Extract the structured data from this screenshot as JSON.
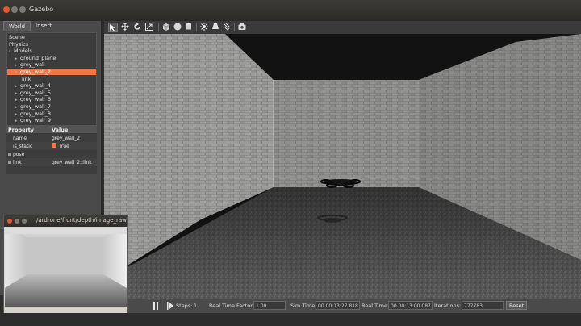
{
  "window": {
    "title": "Gazebo"
  },
  "left_panel": {
    "tabs": [
      "World",
      "Insert"
    ],
    "tree": [
      {
        "label": "Scene",
        "indent": 0
      },
      {
        "label": "Physics",
        "indent": 0
      },
      {
        "label": "Models",
        "indent": 0,
        "expanded": true
      },
      {
        "label": "ground_plane",
        "indent": 1
      },
      {
        "label": "grey_wall",
        "indent": 1
      },
      {
        "label": "grey_wall_2",
        "indent": 1,
        "selected": true
      },
      {
        "label": "link",
        "indent": 2
      },
      {
        "label": "grey_wall_4",
        "indent": 1
      },
      {
        "label": "grey_wall_5",
        "indent": 1
      },
      {
        "label": "grey_wall_6",
        "indent": 1
      },
      {
        "label": "grey_wall_7",
        "indent": 1
      },
      {
        "label": "grey_wall_8",
        "indent": 1
      },
      {
        "label": "grey_wall_9",
        "indent": 1
      }
    ],
    "properties": {
      "header": [
        "Property",
        "Value"
      ],
      "rows": [
        {
          "name": "name",
          "value": "grey_wall_2"
        },
        {
          "name": "is_static",
          "value": "True"
        },
        {
          "name": "pose",
          "value": ""
        },
        {
          "name": "link",
          "value": "grey_wall_2::link"
        }
      ]
    }
  },
  "toolbar": {
    "icons": [
      "select-arrow-icon",
      "translate-icon",
      "rotate-icon",
      "scale-icon",
      "box-icon",
      "sphere-icon",
      "cylinder-icon",
      "point-light-icon",
      "spot-light-icon",
      "directional-light-icon",
      "screenshot-icon"
    ]
  },
  "statusbar": {
    "steps_label": "Steps:",
    "steps_value": "1",
    "rtf_label": "Real Time Factor:",
    "rtf_value": "1.00",
    "sim_time_label": "Sim Time:",
    "sim_time_value": "00 00:13:27.818",
    "real_time_label": "Real Time:",
    "real_time_value": "00 00:13:00.087",
    "iterations_label": "Iterations:",
    "iterations_value": "777783",
    "reset_label": "Reset"
  },
  "image_view": {
    "title": "/ardrone/front/depth/image_raw"
  },
  "colors": {
    "accent": "#f07746",
    "panel": "#4a4a4a",
    "titlebar": "#3c3b37"
  }
}
